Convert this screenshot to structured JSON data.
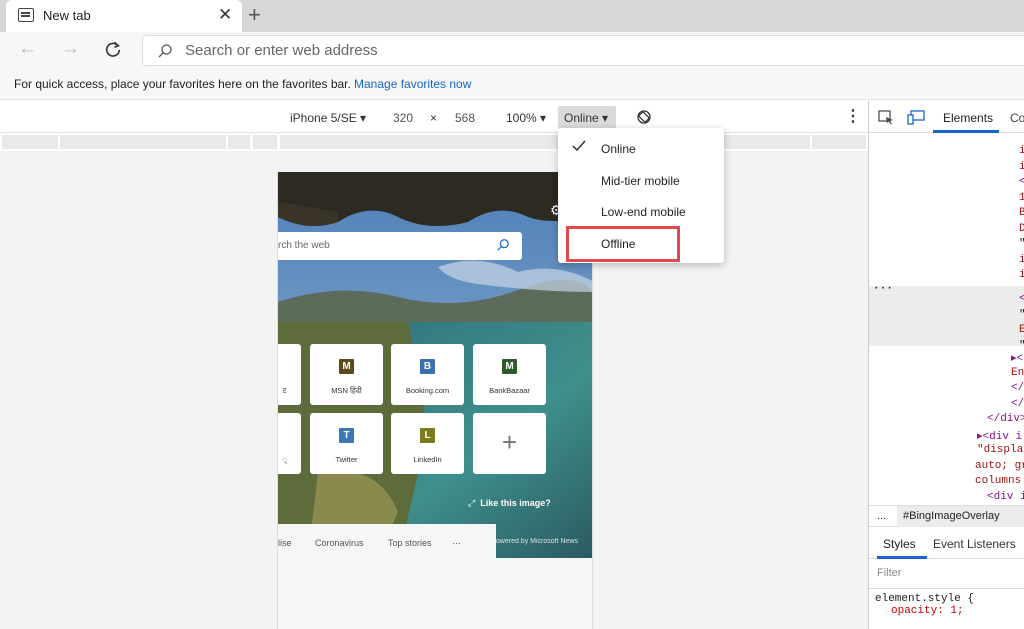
{
  "browser": {
    "tab_title": "New tab",
    "address_placeholder": "Search or enter web address"
  },
  "favorites_bar": {
    "message": "For quick access, place your favorites here on the favorites bar.",
    "link": "Manage favorites now"
  },
  "device_toolbar": {
    "device": "iPhone 5/SE ▾",
    "width": "320",
    "times": "×",
    "height": "568",
    "zoom": "100% ▾",
    "throttle": "Online ▾"
  },
  "throttle_menu": {
    "items": [
      "Online",
      "Mid-tier mobile",
      "Low-end mobile",
      "Offline"
    ],
    "selected": "Online",
    "highlighted": "Offline"
  },
  "new_tab_page": {
    "search_placeholder": "rch the web",
    "tiles": [
      {
        "label": "ट",
        "badge": "",
        "color": ""
      },
      {
        "label": "MSN हिंदी",
        "badge": "M",
        "color": "#5a4a1c"
      },
      {
        "label": "Booking.com",
        "badge": "B",
        "color": "#3b6fb0"
      },
      {
        "label": "BankBazaar",
        "badge": "M",
        "color": "#2e5a2e"
      },
      {
        "label": "्",
        "badge": "",
        "color": ""
      },
      {
        "label": "Twitter",
        "badge": "T",
        "color": "#3b78b5"
      },
      {
        "label": "LinkedIn",
        "badge": "L",
        "color": "#7c7a1a"
      },
      {
        "label": "",
        "badge": "+",
        "color": ""
      }
    ],
    "like_image": "Like this image?",
    "nav": [
      "lise",
      "Coronavirus",
      "Top stories",
      "···"
    ],
    "powered_by": "powered by Microsoft News"
  },
  "devtools": {
    "active_tab": "Elements",
    "next_tab": "Co",
    "dom_lines": [
      {
        "t": "i",
        "c": "#a31515"
      },
      {
        "t": "i",
        "c": "#a31515"
      },
      {
        "t": "<",
        "c": "#881280"
      },
      {
        "t": "1",
        "c": "#a31515"
      },
      {
        "t": "B",
        "c": "#a31515"
      },
      {
        "t": "D",
        "c": "#a31515"
      },
      {
        "t": "\"",
        "c": "#222"
      },
      {
        "t": "i",
        "c": "#a31515"
      },
      {
        "t": "i",
        "c": "#a31515"
      },
      {
        "t": "<",
        "c": "#881280"
      },
      {
        "t": "\"",
        "c": "#222"
      },
      {
        "t": "E",
        "c": "#a31515"
      },
      {
        "t": "\"",
        "c": "#222"
      }
    ],
    "dom_lines_bottom": [
      "▸<",
      "En",
      "</",
      "</di",
      "</div>",
      "▸<div i",
      "\"displa",
      "auto; gr",
      "columns:",
      "<div i"
    ],
    "breadcrumb_dots": "...",
    "breadcrumb": "#BingImageOverlay",
    "styles_tab": "Styles",
    "event_tab": "Event Listeners",
    "filter_placeholder": "Filter",
    "element_style": "element.style {",
    "opacity": "opacity: 1;"
  },
  "colors": {
    "accent": "#1a65c9",
    "highlight_box": "#e04a4a"
  }
}
